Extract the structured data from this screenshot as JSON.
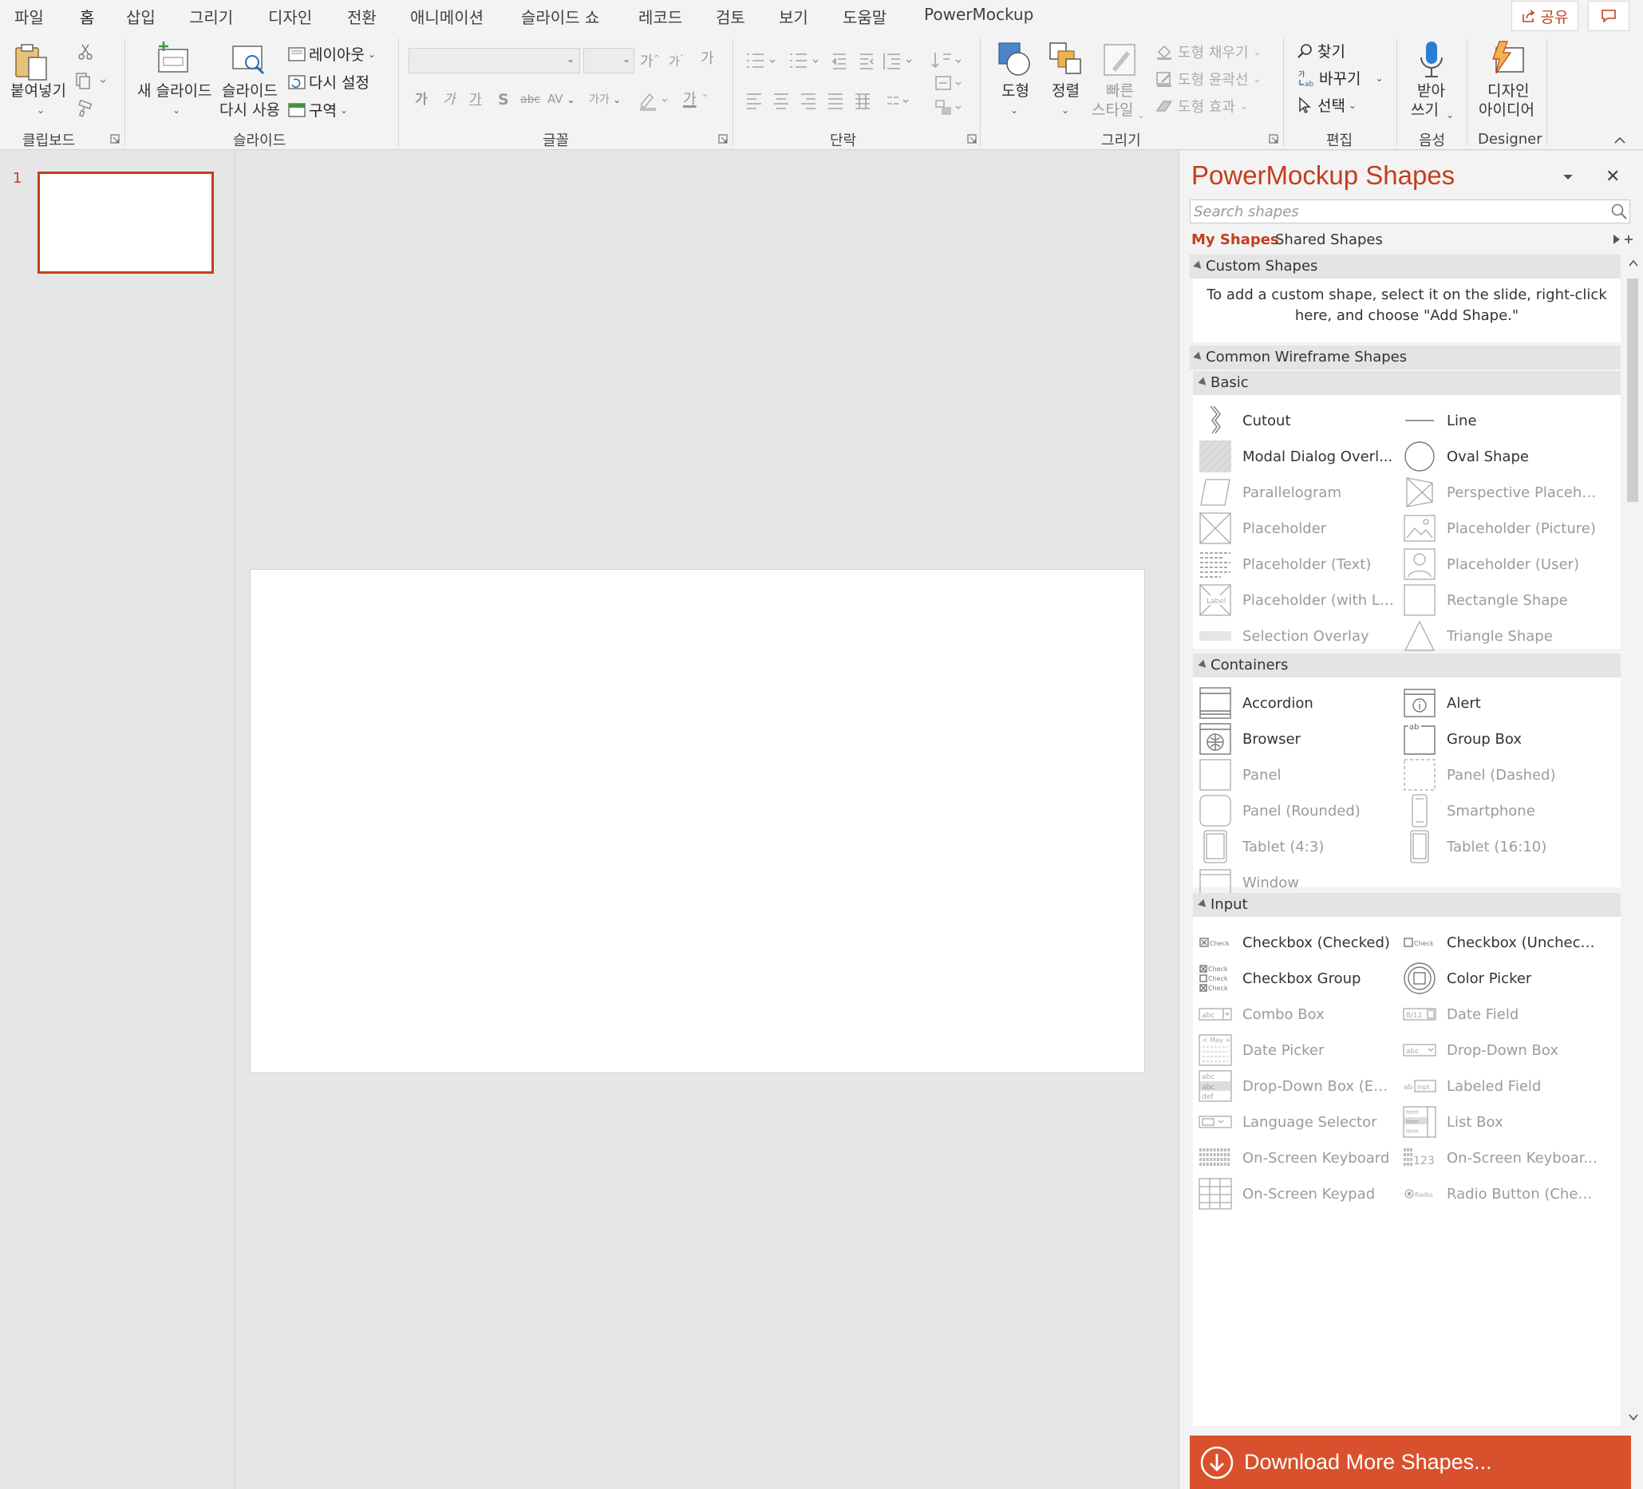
{
  "menu": {
    "items": [
      "파일",
      "홈",
      "삽입",
      "그리기",
      "디자인",
      "전환",
      "애니메이션",
      "슬라이드 쇼",
      "레코드",
      "검토",
      "보기",
      "도움말",
      "PowerMockup"
    ],
    "active": "홈",
    "share_label": "공유"
  },
  "ribbon": {
    "clipboard": {
      "paste": "붙여넣기",
      "group": "클립보드"
    },
    "slides": {
      "new_slide": "새 슬라이드",
      "reuse_1": "슬라이드",
      "reuse_2": "다시 사용",
      "layout": "레이아웃",
      "reset": "다시 설정",
      "section": "구역",
      "group": "슬라이드"
    },
    "font": {
      "group": "글꼴",
      "bold": "가",
      "italic": "가",
      "underline": "가",
      "strike": "S",
      "spacing": "가가",
      "grow": "가",
      "shrink": "가",
      "clear": "가",
      "highlight": "가"
    },
    "paragraph": {
      "group": "단락"
    },
    "drawing": {
      "shapes": "도형",
      "arrange": "정렬",
      "quick_1": "빠른",
      "quick_2": "스타일",
      "fill": "도형 채우기",
      "outline": "도형 윤곽선",
      "effects": "도형 효과",
      "group": "그리기"
    },
    "editing": {
      "find": "찾기",
      "replace": "바꾸기",
      "select": "선택",
      "group": "편집"
    },
    "voice": {
      "dictate_1": "받아",
      "dictate_2": "쓰기",
      "group": "음성"
    },
    "designer": {
      "ideas_1": "디자인",
      "ideas_2": "아이디어",
      "group": "Designer"
    }
  },
  "thumbnails": {
    "slide_number": "1"
  },
  "pane": {
    "title": "PowerMockup Shapes",
    "search_placeholder": "Search shapes",
    "tab_my": "My Shapes",
    "tab_shared": "Shared Shapes",
    "custom_section": "Custom Shapes",
    "custom_hint": "To add a custom shape, select it on the slide, right-click here, and choose \"Add Shape.\"",
    "common_section": "Common Wireframe Shapes",
    "basic": {
      "label": "Basic",
      "items": [
        {
          "label": "Cutout",
          "icon": "cutout-icon"
        },
        {
          "label": "Line",
          "icon": "line-icon"
        },
        {
          "label": "Modal  Dialog Overl...",
          "icon": "modal-overlay-icon"
        },
        {
          "label": "Oval Shape",
          "icon": "oval-icon"
        },
        {
          "label": "Parallelogram",
          "icon": "parallelogram-icon"
        },
        {
          "label": "Perspective Placeho...",
          "icon": "perspective-placeholder-icon"
        },
        {
          "label": "Placeholder",
          "icon": "placeholder-icon"
        },
        {
          "label": "Placeholder (Picture)",
          "icon": "picture-placeholder-icon"
        },
        {
          "label": "Placeholder (Text)",
          "icon": "text-placeholder-icon"
        },
        {
          "label": "Placeholder (User)",
          "icon": "user-placeholder-icon"
        },
        {
          "label": "Placeholder  (with La...",
          "icon": "label-placeholder-icon"
        },
        {
          "label": "Rectangle Shape",
          "icon": "rectangle-icon"
        },
        {
          "label": "Selection Overlay",
          "icon": "selection-overlay-icon"
        },
        {
          "label": "Triangle Shape",
          "icon": "triangle-icon"
        }
      ]
    },
    "containers": {
      "label": "Containers",
      "items": [
        {
          "label": "Accordion",
          "icon": "accordion-icon"
        },
        {
          "label": "Alert",
          "icon": "alert-icon"
        },
        {
          "label": "Browser",
          "icon": "browser-icon"
        },
        {
          "label": "Group Box",
          "icon": "group-box-icon"
        },
        {
          "label": "Panel",
          "icon": "panel-icon"
        },
        {
          "label": "Panel (Dashed)",
          "icon": "panel-dashed-icon"
        },
        {
          "label": "Panel (Rounded)",
          "icon": "panel-rounded-icon"
        },
        {
          "label": "Smartphone",
          "icon": "smartphone-icon"
        },
        {
          "label": "Tablet (4:3)",
          "icon": "tablet-43-icon"
        },
        {
          "label": "Tablet (16:10)",
          "icon": "tablet-1610-icon"
        },
        {
          "label": "Window",
          "icon": "window-icon"
        }
      ]
    },
    "input": {
      "label": "Input",
      "items": [
        {
          "label": "Checkbox (Checked)",
          "icon": "checkbox-checked-icon"
        },
        {
          "label": "Checkbox (Uncheck...",
          "icon": "checkbox-unchecked-icon"
        },
        {
          "label": "Checkbox Group",
          "icon": "checkbox-group-icon"
        },
        {
          "label": "Color Picker",
          "icon": "color-picker-icon"
        },
        {
          "label": "Combo Box",
          "icon": "combo-box-icon"
        },
        {
          "label": "Date Field",
          "icon": "date-field-icon"
        },
        {
          "label": "Date Picker",
          "icon": "date-picker-icon"
        },
        {
          "label": "Drop-Down Box",
          "icon": "dropdown-box-icon"
        },
        {
          "label": "Drop-Down  Box (Ex...",
          "icon": "dropdown-expanded-icon"
        },
        {
          "label": "Labeled Field",
          "icon": "labeled-field-icon"
        },
        {
          "label": "Language Selector",
          "icon": "language-selector-icon"
        },
        {
          "label": "List Box",
          "icon": "list-box-icon"
        },
        {
          "label": "On-Screen Keyboard",
          "icon": "keyboard-icon"
        },
        {
          "label": "On-Screen  Keyboar...",
          "icon": "keyboard-numeric-icon"
        },
        {
          "label": "On-Screen Keypad",
          "icon": "keypad-icon"
        },
        {
          "label": "Radio  Button (Chec...",
          "icon": "radio-checked-icon"
        }
      ]
    },
    "icon_text": {
      "check": "Check",
      "abc": "abc",
      "date": "8/12",
      "may": "< May >",
      "ab": "ab",
      "inpt": "Inpt",
      "label": "Label",
      "radio": "Radio",
      "def": "def",
      "item": "Item",
      "num": "123"
    },
    "download_label": "Download More Shapes...",
    "colors": {
      "accent": "#c43e1c",
      "download_bg": "#d9512c"
    }
  }
}
